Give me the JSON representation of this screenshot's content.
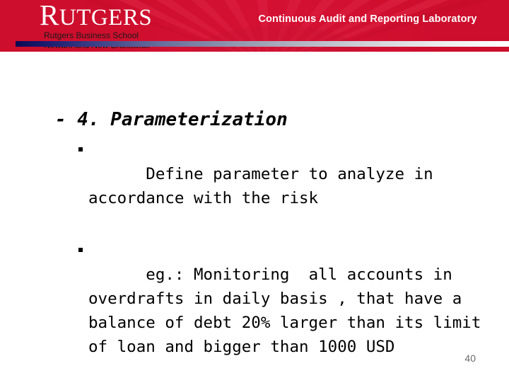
{
  "banner": {
    "title": "Continuous Audit and Reporting Laboratory",
    "background_color": "#ce0e2d",
    "logo": {
      "wordmark_cap": "R",
      "wordmark_rest": "UTGERS",
      "sub_line_1": "Rutgers Business School",
      "sub_line_2": "Newark and New Brunswick"
    },
    "gradient_bar": {
      "start_color": "#0d0a52",
      "end_color": "#ffffff"
    }
  },
  "slide": {
    "heading": "- 4. Parameterization",
    "bullets": [
      "Define parameter to analyze in accordance with the risk",
      "eg.: Monitoring  all accounts in overdrafts in daily basis , that have a balance of debt 20% larger than its limit of loan and bigger than 1000 USD"
    ],
    "page_number": "40",
    "text_color": "#000000",
    "page_number_color": "#6b6b6b"
  }
}
